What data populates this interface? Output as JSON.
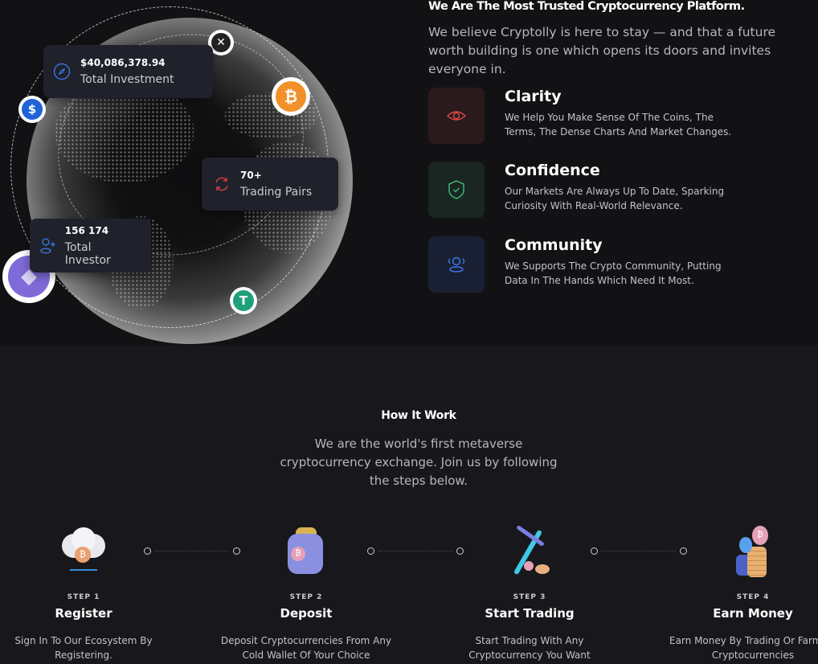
{
  "stats": [
    {
      "value": "$40,086,378.94",
      "label": "Total Investment",
      "icon": "compass-icon"
    },
    {
      "value": "70+",
      "label": "Trading Pairs",
      "icon": "refresh-icon"
    },
    {
      "value": "156 174",
      "label": "Total Investor",
      "icon": "user-plus-icon"
    }
  ],
  "coins": {
    "btc": "₿",
    "usd": "$",
    "usdt": "T",
    "xrp": "✕",
    "eth": "◆"
  },
  "about": {
    "title": "We Are The Most Trusted Cryptocurrency Platform.",
    "text": "We believe Cryptolly is here to stay — and that a future worth building is one which opens its doors and invites everyone in.",
    "features": [
      {
        "title": "Clarity",
        "desc": "We Help You Make Sense Of The Coins, The Terms, The Dense Charts And Market Changes.",
        "icon": "eye-icon",
        "color": "#e04848"
      },
      {
        "title": "Confidence",
        "desc": "Our Markets Are Always Up To Date, Sparking Curiosity With Real-World Relevance.",
        "icon": "shield-check-icon",
        "color": "#3fbf78"
      },
      {
        "title": "Community",
        "desc": "We Supports The Crypto Community, Putting Data In The Hands Which Need It Most.",
        "icon": "users-icon",
        "color": "#3d7bf0"
      }
    ]
  },
  "how": {
    "title": "How It Work",
    "text": "We are the world's first metaverse cryptocurrency exchange. Join us by following the steps below.",
    "steps": [
      {
        "label": "STEP 1",
        "title": "Register",
        "desc": "Sign In To Our Ecosystem By Registering."
      },
      {
        "label": "STEP 2",
        "title": "Deposit",
        "desc": "Deposit Cryptocurrencies From Any Cold Wallet Of Your Choice"
      },
      {
        "label": "STEP 3",
        "title": "Start Trading",
        "desc": "Start Trading With Any Cryptocurrency You Want"
      },
      {
        "label": "STEP 4",
        "title": "Earn Money",
        "desc": "Earn Money By Trading Or Farming Cryptocurrencies"
      }
    ]
  }
}
